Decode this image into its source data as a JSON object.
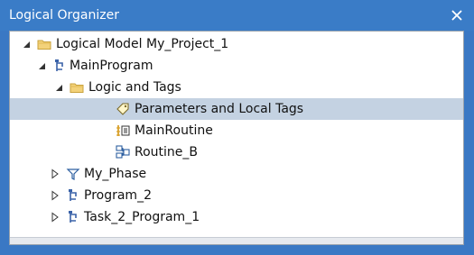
{
  "window": {
    "title": "Logical Organizer",
    "close_glyph": "×"
  },
  "tree": {
    "items": [
      {
        "label": "Logical Model My_Project_1",
        "icon": "folder-icon",
        "expander": "expanded"
      },
      {
        "label": "MainProgram",
        "icon": "program-icon",
        "expander": "expanded"
      },
      {
        "label": "Logic and Tags",
        "icon": "folder-icon",
        "expander": "expanded"
      },
      {
        "label": "Parameters and Local Tags",
        "icon": "tag-icon",
        "expander": "none",
        "selected": true
      },
      {
        "label": "MainRoutine",
        "icon": "ladder-routine-icon",
        "expander": "none"
      },
      {
        "label": "Routine_B",
        "icon": "function-block-routine-icon",
        "expander": "none"
      },
      {
        "label": "My_Phase",
        "icon": "phase-icon",
        "expander": "collapsed"
      },
      {
        "label": "Program_2",
        "icon": "program-icon",
        "expander": "collapsed"
      },
      {
        "label": "Task_2_Program_1",
        "icon": "program-icon",
        "expander": "collapsed"
      }
    ]
  },
  "colors": {
    "titlebar": "#3a7cc7",
    "selection": "#c4d2e2",
    "folder": "#e8c46a"
  }
}
